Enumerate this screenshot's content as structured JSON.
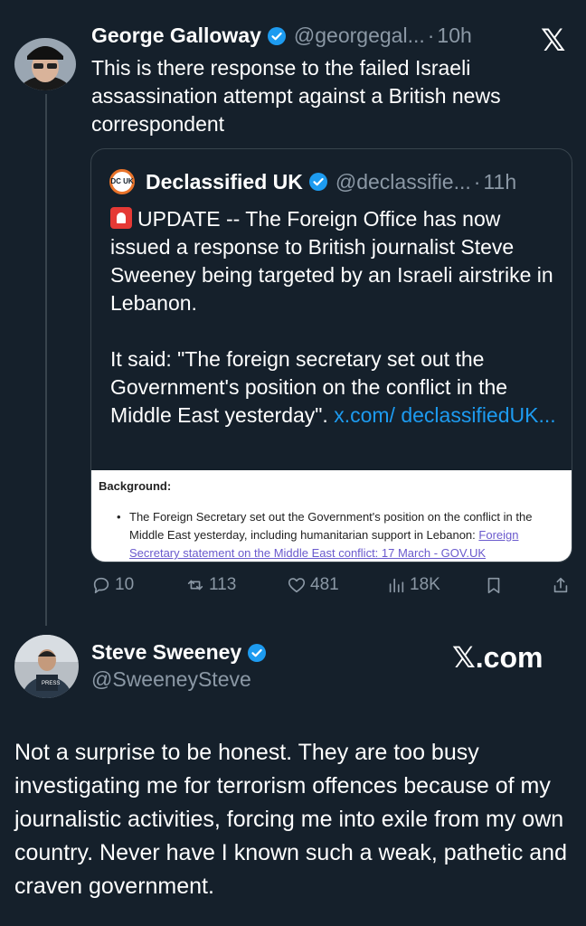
{
  "tweet1": {
    "author_name": "George Galloway",
    "handle": "@georgegal...",
    "separator": "·",
    "time": "10h",
    "text": "This is there response to the failed Israeli assassination attempt against a British news correspondent"
  },
  "x_logo": "𝕏",
  "quote": {
    "logo_text": "DC UK",
    "author_name": "Declassified UK",
    "handle": "@declassifie...",
    "separator": "·",
    "time": "11h",
    "text_part1": "UPDATE -- The Foreign Office has now issued a response to British journalist Steve Sweeney being targeted by an Israeli airstrike in Lebanon.",
    "text_part2": "It said: \"The foreign secretary set out the Government's position on the conflict in the Middle East yesterday\".",
    "link": "x.com/ declassifiedUK...",
    "image": {
      "title": "Background:",
      "bullet": "The Foreign Secretary set out the Government's position on the conflict in the Middle East yesterday, including humanitarian support in Lebanon:",
      "bullet_link": "Foreign Secretary statement on the Middle East conflict: 17 March - GOV.UK"
    }
  },
  "actions": {
    "replies": "10",
    "reposts": "113",
    "likes": "481",
    "views": "18K"
  },
  "tweet2": {
    "author_name": "Steve Sweeney",
    "handle": "@SweeneySteve",
    "text": "Not a surprise to be honest. They are too busy investigating me for terrorism offences because of my journalistic activities, forcing me into exile from my own country.  Never have I known such a weak, pathetic and craven government."
  },
  "watermark": "𝕏.com",
  "colors": {
    "background": "#15202b",
    "accent": "#1d9bf0",
    "muted": "#8b98a5",
    "border": "#38444d"
  }
}
